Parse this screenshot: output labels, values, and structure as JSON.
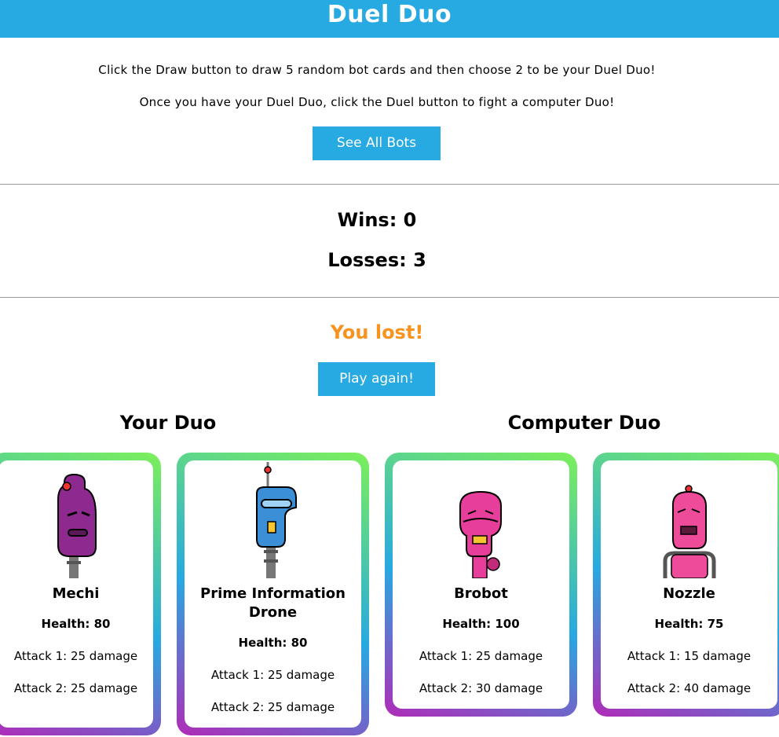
{
  "header": {
    "title": "Duel Duo"
  },
  "instructions": {
    "line1": "Click the Draw button to draw 5 random bot cards and then choose 2 to be your Duel Duo!",
    "line2": "Once you have your Duel Duo, click the Duel button to fight a computer Duo!"
  },
  "buttons": {
    "see_all": "See All Bots",
    "play_again": "Play again!"
  },
  "score": {
    "wins": "Wins: 0",
    "losses": "Losses: 3"
  },
  "result": {
    "text": "You lost!"
  },
  "your_duo": {
    "title": "Your Duo",
    "cards": [
      {
        "name": "Mechi",
        "health": "Health: 80",
        "attack1": "Attack 1: 25 damage",
        "attack2": "Attack 2: 25 damage",
        "icon": "robot-icon",
        "color": "#8e2a8f"
      },
      {
        "name": "Prime Information Drone",
        "health": "Health: 80",
        "attack1": "Attack 1: 25 damage",
        "attack2": "Attack 2: 25 damage",
        "icon": "robot-icon",
        "color": "#3b8fd6"
      }
    ]
  },
  "computer_duo": {
    "title": "Computer Duo",
    "cards": [
      {
        "name": "Brobot",
        "health": "Health: 100",
        "attack1": "Attack 1: 25 damage",
        "attack2": "Attack 2: 30 damage",
        "icon": "robot-icon",
        "color": "#e63e9a"
      },
      {
        "name": "Nozzle",
        "health": "Health: 75",
        "attack1": "Attack 1: 15 damage",
        "attack2": "Attack 2: 40 damage",
        "icon": "robot-icon",
        "color": "#ee4b9a"
      }
    ]
  },
  "colors": {
    "brand": "#27a9e1",
    "lost": "#f7931e"
  }
}
